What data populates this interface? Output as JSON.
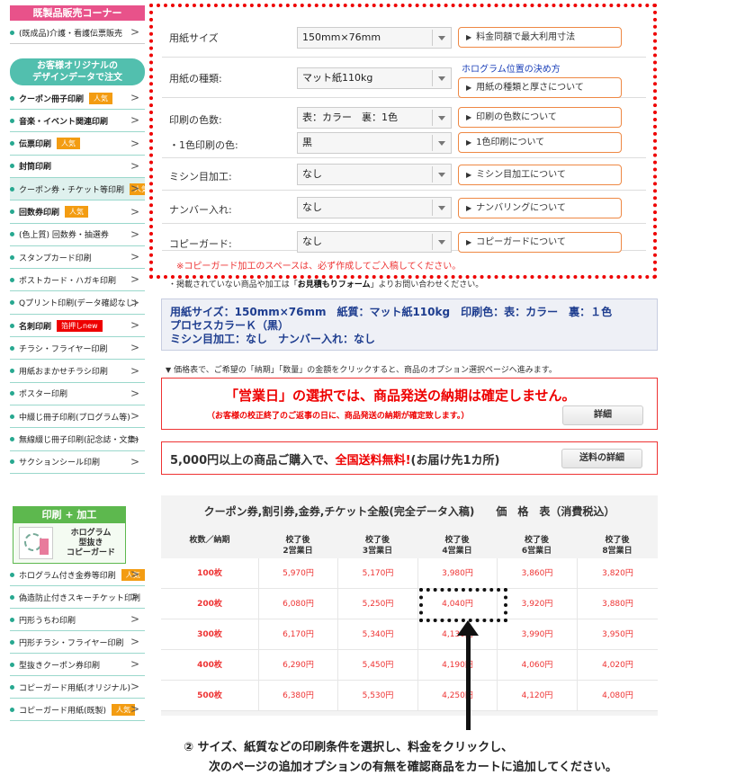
{
  "sidebar": {
    "top_header": "既製品販売コーナー",
    "top_item": "(既成品)介護・看護伝票販売",
    "design_header_l1": "お客様オリジナルの",
    "design_header_l2": "デザインデータで注文",
    "design_items": [
      {
        "label": "クーポン冊子印刷",
        "badge": "人気",
        "bold": true
      },
      {
        "label": "音楽・イベント関連印刷",
        "badge": "",
        "bold": true
      },
      {
        "label": "伝票印刷",
        "badge": "人気",
        "bold": true
      },
      {
        "label": "封筒印刷",
        "badge": "",
        "bold": true
      },
      {
        "label": "クーポン券・チケット等印刷",
        "badge": "人気",
        "bold": false
      },
      {
        "label": "回数券印刷",
        "badge": "人気",
        "bold": true
      },
      {
        "label": "(色上質) 回数券・抽選券",
        "badge": "",
        "bold": false
      },
      {
        "label": "スタンプカード印刷",
        "badge": "",
        "bold": false
      },
      {
        "label": "ポストカード・ハガキ印刷",
        "badge": "",
        "bold": false
      },
      {
        "label": "Qプリント印刷(データ確認なし)",
        "badge": "",
        "bold": false
      },
      {
        "label": "名刺印刷",
        "badge": "箔押しnew",
        "bold": true
      },
      {
        "label": "チラシ・フライヤー印刷",
        "badge": "",
        "bold": false
      },
      {
        "label": "用紙おまかせチラシ印刷",
        "badge": "",
        "bold": false
      },
      {
        "label": "ポスター印刷",
        "badge": "",
        "bold": false
      },
      {
        "label": "中綴じ冊子印刷(プログラム等)",
        "badge": "",
        "bold": false
      },
      {
        "label": "無線綴じ冊子印刷(記念誌・文集)",
        "badge": "",
        "bold": false
      },
      {
        "label": "サクションシール印刷",
        "badge": "",
        "bold": false
      }
    ],
    "kakou_header": "印刷 + 加工",
    "kakou_text_l1": "ホログラム",
    "kakou_text_l2": "型抜き",
    "kakou_text_l3": "コピーガード",
    "kakou_items": [
      {
        "label": "ホログラム付き金券等印刷",
        "badge": "人気"
      },
      {
        "label": "偽造防止付きスキーチケット印刷",
        "badge": ""
      },
      {
        "label": "円形うちわ印刷",
        "badge": ""
      },
      {
        "label": "円形チラシ・フライヤー印刷",
        "badge": ""
      },
      {
        "label": "型抜きクーポン券印刷",
        "badge": ""
      },
      {
        "label": "コピーガード用紙(オリジナル)",
        "badge": ""
      },
      {
        "label": "コピーガード用紙(既製)",
        "badge": "人気"
      }
    ],
    "arrow": ">"
  },
  "options": {
    "rows": [
      {
        "label": "用紙サイズ",
        "value": "150mm×76mm",
        "button": "料金同額で最大利用寸法"
      },
      {
        "label": "用紙の種類:",
        "value": "マット紙110kg",
        "button": "用紙の種類と厚さについて"
      },
      {
        "label": "印刷の色数:",
        "value": "表：カラー　裏：1色",
        "button": "印刷の色数について"
      },
      {
        "label": "・1色印刷の色:",
        "value": "黒",
        "button": "1色印刷について"
      },
      {
        "label": "ミシン目加工:",
        "value": "なし",
        "button": "ミシン目加工について"
      },
      {
        "label": "ナンバー入れ:",
        "value": "なし",
        "button": "ナンバリングについて"
      },
      {
        "label": "コピーガード:",
        "value": "なし",
        "button": "コピーガードについて"
      }
    ],
    "hologram_link": "ホログラム位置の決め方",
    "note": "※コピーガード加工のスペースは、必ず作成してご入稿してください。",
    "button_tri": "▶"
  },
  "mitsumori": {
    "prefix": "・掲載されていない商品や加工は「",
    "bold": "お見積もりフォーム",
    "suffix": "」よりお問い合わせください。"
  },
  "summary": {
    "line1": "用紙サイズ：150mm×76mm　紙質：マット紙110kg　印刷色：表：カラー　裏：１色",
    "line2": "プロセスカラーＫ（黒）",
    "line3": "ミシン目加工：なし　ナンバー入れ：なし"
  },
  "hint": {
    "tri": "▼",
    "text": "価格表で、ご希望の「納期」「数量」の金額をクリックすると、商品のオプション選択ページへ進みます。"
  },
  "notice": {
    "title": "「営業日」の選択では、商品発送の納期は確定しません。",
    "sub": "（お客様の校正終了のご返事の日に、商品発送の納期が確定致します。）",
    "button": "詳細"
  },
  "freeship": {
    "prefix": "5,000円以上の商品ご購入で、",
    "red": "全国送料無料!",
    "suffix": "(お届け先1カ所)",
    "button": "送料の詳細"
  },
  "price_table": {
    "title": "クーポン券,割引券,金券,チケット全般(完全データ入稿)　　価　格　表（消費税込）",
    "qty_header": "枚数／納期",
    "columns": [
      {
        "l1": "校了後",
        "l2": "2営業日"
      },
      {
        "l1": "校了後",
        "l2": "3営業日"
      },
      {
        "l1": "校了後",
        "l2": "4営業日"
      },
      {
        "l1": "校了後",
        "l2": "6営業日"
      },
      {
        "l1": "校了後",
        "l2": "8営業日"
      }
    ],
    "rows": [
      {
        "qty": "100枚",
        "prices": [
          "5,970円",
          "5,170円",
          "3,980円",
          "3,860円",
          "3,820円"
        ]
      },
      {
        "qty": "200枚",
        "prices": [
          "6,080円",
          "5,250円",
          "4,040円",
          "3,920円",
          "3,880円"
        ]
      },
      {
        "qty": "300枚",
        "prices": [
          "6,170円",
          "5,340円",
          "4,130円",
          "3,990円",
          "3,950円"
        ]
      },
      {
        "qty": "400枚",
        "prices": [
          "6,290円",
          "5,450円",
          "4,190円",
          "4,060円",
          "4,020円"
        ]
      },
      {
        "qty": "500枚",
        "prices": [
          "6,380円",
          "5,530円",
          "4,250円",
          "4,120円",
          "4,080円"
        ]
      }
    ]
  },
  "caption": {
    "line1": "② サイズ、紙質などの印刷条件を選択し、料金をクリックし、",
    "line2": "次のページの追加オプションの有無を確認商品をカートに追加してください。"
  }
}
